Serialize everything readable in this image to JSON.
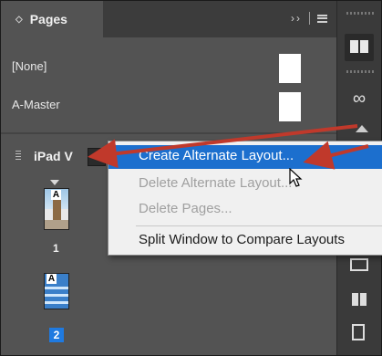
{
  "panel": {
    "tab_label": "Pages",
    "tab_collapse_glyph": "››",
    "masters": [
      "[None]",
      "A-Master"
    ],
    "layout_name": "iPad V",
    "pages": [
      {
        "number": "1",
        "master_letter": "A",
        "selected": false
      },
      {
        "number": "2",
        "master_letter": "A",
        "selected": true
      }
    ]
  },
  "context_menu": {
    "items": [
      {
        "label": "Create Alternate Layout...",
        "state": "highlighted"
      },
      {
        "label": "Delete Alternate Layout...",
        "state": "disabled"
      },
      {
        "label": "Delete Pages...",
        "state": "disabled"
      },
      {
        "label": "Split Window to Compare Layouts",
        "state": "enabled"
      }
    ]
  },
  "toolbar": {
    "icons": [
      "pages-icon",
      "links-icon",
      "rectangle-icon",
      "grid-icon",
      "book-icon"
    ]
  },
  "colors": {
    "panel_bg": "#535353",
    "tab_bar_bg": "#3c3c3c",
    "highlight": "#1c6fce",
    "callout": "#c0392b",
    "selected_page": "#1f7ae0"
  }
}
